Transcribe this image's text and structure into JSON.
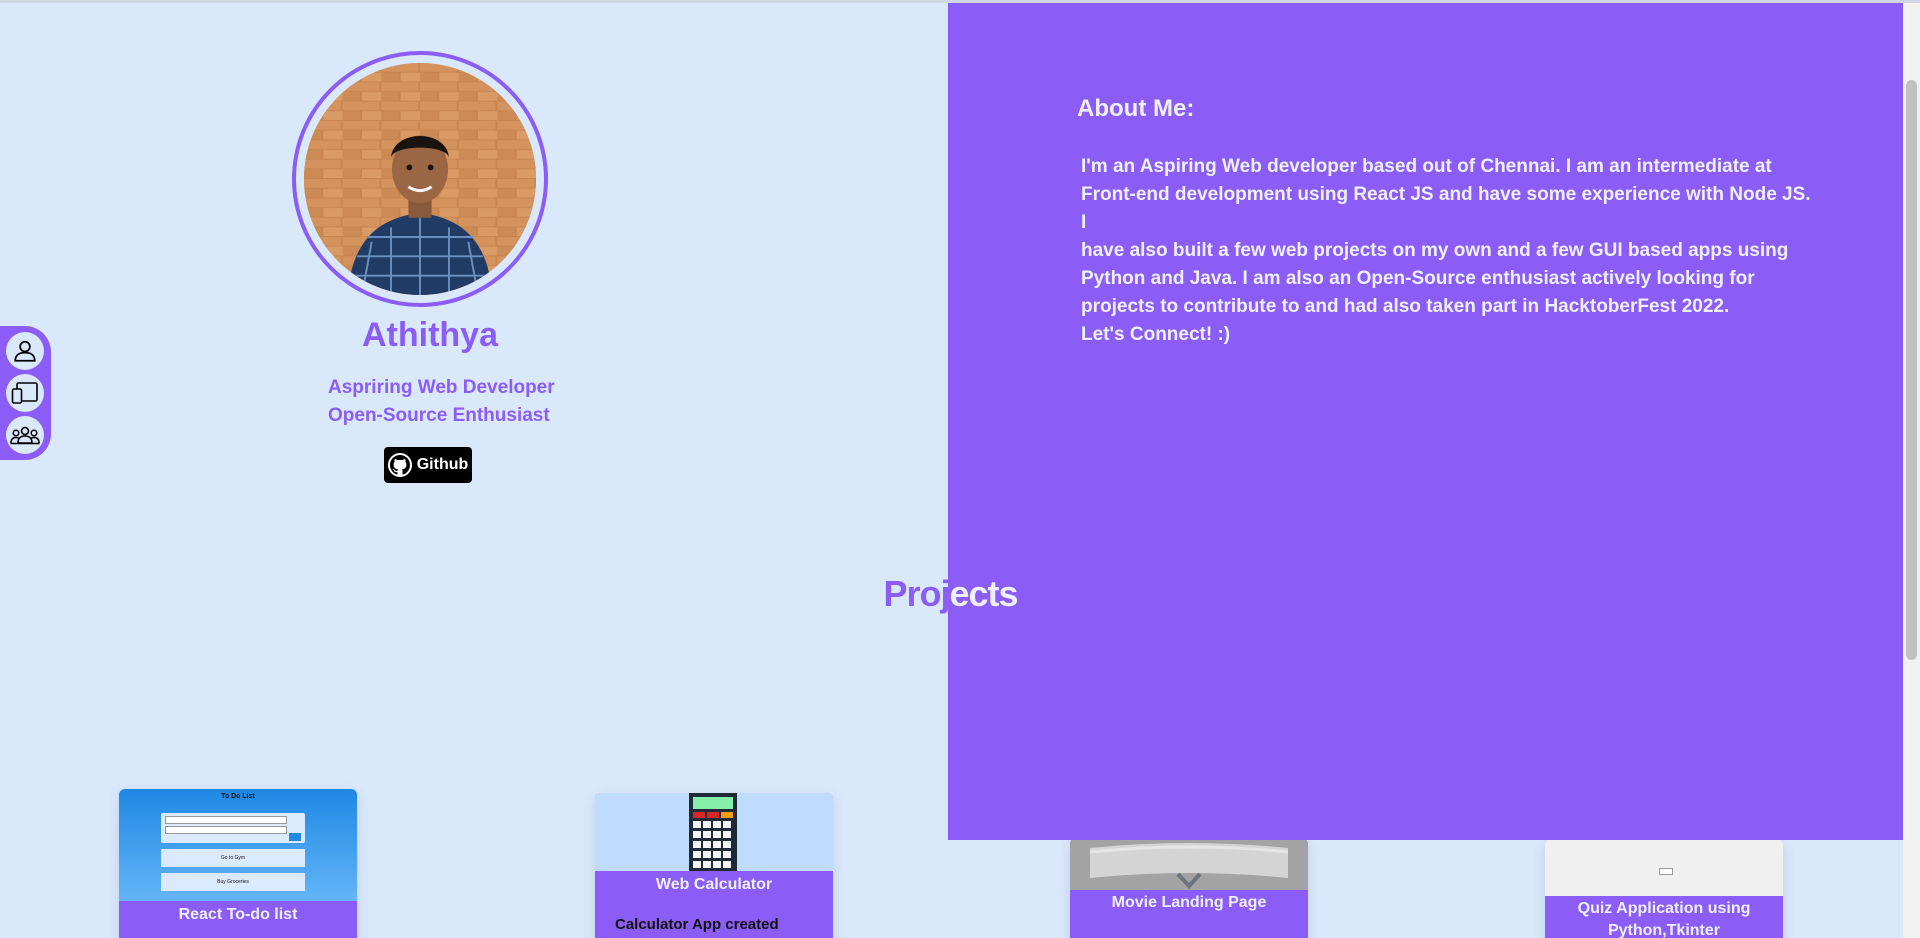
{
  "profile": {
    "name": "Athithya",
    "tagline_line1": "Aspriring Web Developer",
    "tagline_line2": "Open-Source Enthusiast",
    "github_label": "Github"
  },
  "about": {
    "title": "About Me:",
    "lines": [
      "I'm an Aspiring Web developer based out of Chennai. I am an intermediate at",
      "Front-end development using React JS and have some experience with Node JS. I",
      "have also built a few web projects on my own and a few GUI based apps using",
      "Python and Java. I am also an Open-Source enthusiast actively looking for",
      "projects to contribute to and had also taken part in HacktoberFest 2022.",
      "Let's Connect! :)"
    ]
  },
  "side_nav": {
    "icons": [
      "person-icon",
      "devices-icon",
      "group-icon"
    ]
  },
  "projects": {
    "heading": "Projects",
    "cards": [
      {
        "title": "React To-do list",
        "thumb_title": "To Do List",
        "thumb_items": [
          "Go to Gym",
          "Buy Groceries"
        ]
      },
      {
        "title": "Web Calculator",
        "description": "Calculator App created"
      },
      {
        "title": "Movie Landing Page"
      },
      {
        "title": "Quiz Application using",
        "title_line2": "Python,Tkinter"
      }
    ]
  },
  "colors": {
    "accent": "#8b5cf6",
    "background": "#dae8fc",
    "panel_text": "#eef0ff"
  }
}
